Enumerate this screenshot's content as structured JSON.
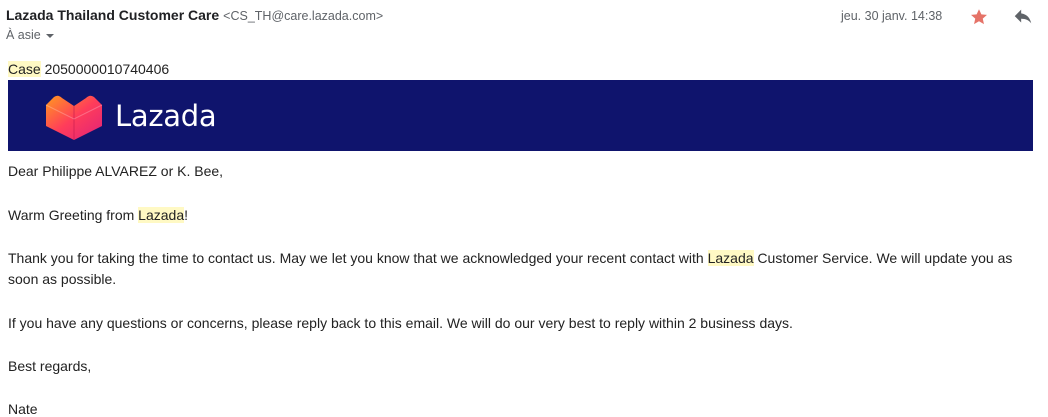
{
  "header": {
    "sender_name": "Lazada Thailand Customer Care",
    "sender_email": "<CS_TH@care.lazada.com>",
    "to_label": "À asie",
    "date": "jeu. 30 janv. 14:38",
    "star_icon": "star-icon",
    "reply_icon": "reply-icon",
    "star_color": "#e57368"
  },
  "email": {
    "case_word": "Case",
    "case_number": "2050000010740406",
    "banner": {
      "logo_text": "Lazada",
      "bg_color": "#0f146d"
    },
    "greeting": "Dear Philippe ALVAREZ or K. Bee,",
    "warm_prefix": "Warm Greeting from ",
    "brand": "Lazada",
    "warm_suffix": "!",
    "para1_prefix": "Thank you for taking the time to contact us. May we let you know that we acknowledged your recent contact with ",
    "para1_suffix": " Customer Service. We will update you as",
    "para1_line2": "soon as possible.",
    "para2": "If you have any questions or concerns, please reply back to this email. We will do our very best to reply within 2 business days.",
    "closing": "Best regards,",
    "signature": "Nate"
  }
}
